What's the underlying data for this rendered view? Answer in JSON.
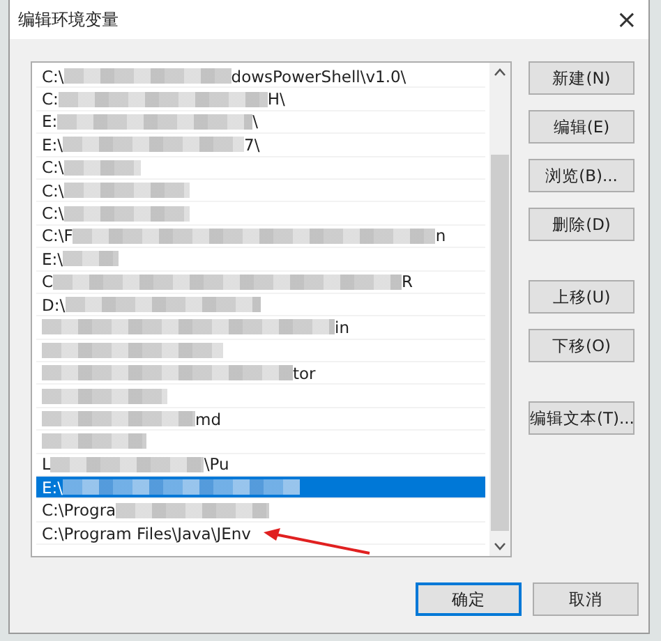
{
  "window": {
    "title": "编辑环境变量",
    "close": "×"
  },
  "list": {
    "rows": [
      {
        "prefix": "C:\\",
        "redacted": true,
        "suffix": "dowsPowerShell\\v1.0\\",
        "selected": false
      },
      {
        "prefix": "C:",
        "redacted": true,
        "suffix": "H\\",
        "selected": false
      },
      {
        "prefix": "E:",
        "redacted": true,
        "suffix": "\\",
        "selected": false
      },
      {
        "prefix": "E:\\",
        "redacted": true,
        "suffix": "7\\",
        "selected": false
      },
      {
        "prefix": "C:\\",
        "redacted": true,
        "selected": false
      },
      {
        "prefix": "C:\\",
        "redacted": true,
        "selected": false
      },
      {
        "prefix": "C:\\",
        "redacted": true,
        "selected": false
      },
      {
        "prefix": "C:\\F",
        "redacted": true,
        "suffix": "n",
        "selected": false
      },
      {
        "prefix": "E:\\",
        "redacted": true,
        "selected": false
      },
      {
        "prefix": "C",
        "redacted": true,
        "suffix": "R",
        "selected": false
      },
      {
        "prefix": "D:\\",
        "redacted": true,
        "selected": false
      },
      {
        "redacted": true,
        "suffix": "in",
        "selected": false
      },
      {
        "redacted": true,
        "selected": false
      },
      {
        "redacted": true,
        "suffix": "tor",
        "selected": false
      },
      {
        "redacted": true,
        "selected": false
      },
      {
        "redacted": true,
        "suffix": "md",
        "selected": false
      },
      {
        "redacted": true,
        "selected": false
      },
      {
        "prefix": "L",
        "redacted": true,
        "suffix": "\\Pu",
        "selected": false
      },
      {
        "prefix": "E:\\",
        "redacted": true,
        "selected": true
      },
      {
        "prefix": "C:\\Progra",
        "redacted": true,
        "selected": false
      },
      {
        "prefix": "C:\\Program Files\\Java\\JEnv",
        "redacted": false,
        "selected": false,
        "annotated": true
      }
    ]
  },
  "side_button_groups": [
    [
      "新建(N)",
      "编辑(E)",
      "浏览(B)...",
      "删除(D)"
    ],
    [
      "上移(U)",
      "下移(O)"
    ],
    [
      "编辑文本(T)..."
    ]
  ],
  "footer_buttons": [
    {
      "label": "确定",
      "default": true
    },
    {
      "label": "取消",
      "default": false
    }
  ]
}
